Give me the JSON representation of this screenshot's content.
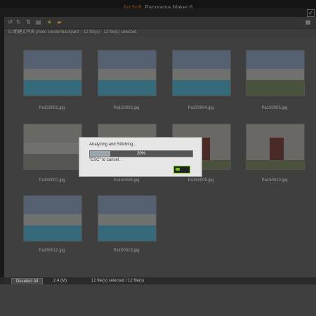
{
  "app": {
    "title_brand": "ArcSoft",
    "title_name": "Panorama Maker 6"
  },
  "path": {
    "text": "E:\\新建文件夹 photo creater\\backyard – 12 file(s) · 12 file(s) selected"
  },
  "thumbnails": [
    {
      "name": "Pa150002.jpg"
    },
    {
      "name": "Pa150003.jpg"
    },
    {
      "name": "Pa150004.jpg"
    },
    {
      "name": "Pa150005.jpg"
    },
    {
      "name": "Pa150007.jpg"
    },
    {
      "name": "Pa150008.jpg"
    },
    {
      "name": "Pa150009.jpg"
    },
    {
      "name": "Pa150010.jpg"
    },
    {
      "name": "Pa150012.jpg"
    },
    {
      "name": "Pa150013.jpg"
    }
  ],
  "dialog": {
    "title": "Analyzing and Stitching...",
    "progress_percent": 20,
    "progress_label": "20%",
    "hint": "\"ESC\" to cancel."
  },
  "status": {
    "deselect_label": "Deselect All",
    "size": "2.4 (M)",
    "count": "12 file(s) selected / 12 file(s)"
  },
  "colors": {
    "brand": "#c9652a",
    "accent": "#76b900"
  }
}
